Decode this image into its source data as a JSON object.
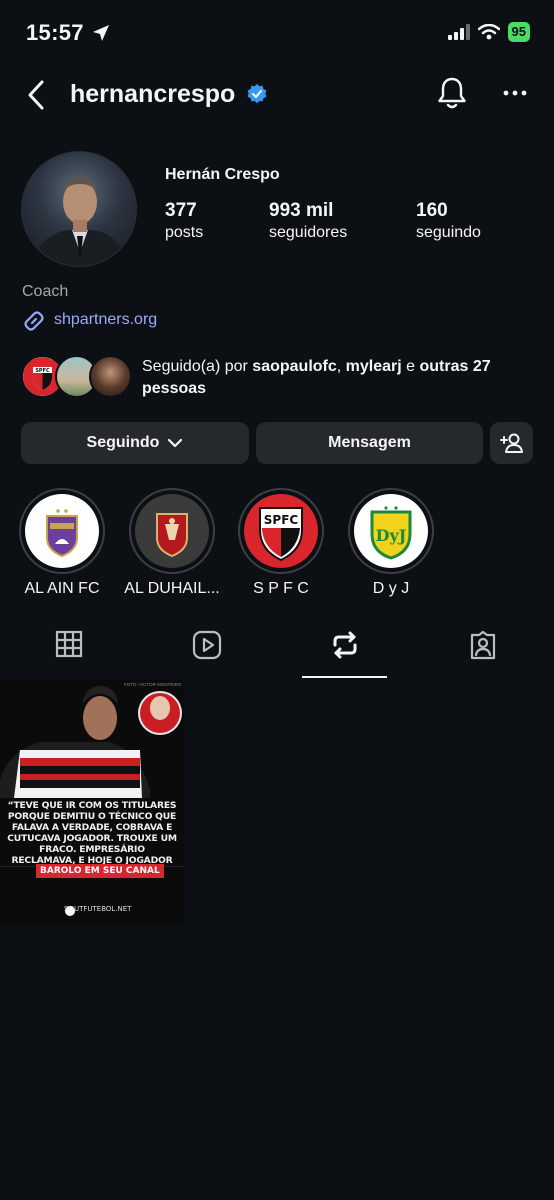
{
  "status_bar": {
    "time": "15:57",
    "battery": "95"
  },
  "header": {
    "username": "hernancrespo"
  },
  "profile": {
    "full_name": "Hernán Crespo",
    "stats": [
      {
        "value": "377",
        "label": "posts"
      },
      {
        "value": "993 mil",
        "label": "seguidores"
      },
      {
        "value": "160",
        "label": "seguindo"
      }
    ],
    "bio": "Coach",
    "link": "shpartners.org",
    "followed_by": {
      "prefix": "Seguido(a) por ",
      "user1": "saopaulofc",
      "sep": ", ",
      "user2": "mylearj",
      "mid": " e ",
      "rest": "outras 27 pessoas"
    }
  },
  "buttons": {
    "following": "Seguindo",
    "message": "Mensagem"
  },
  "highlights": [
    {
      "label": "AL AIN FC"
    },
    {
      "label": "AL DUHAIL..."
    },
    {
      "label": "S P F C"
    },
    {
      "label": "D y J"
    }
  ],
  "tabs": [
    {
      "name": "grid",
      "icon": "grid-icon"
    },
    {
      "name": "reels",
      "icon": "reels-icon"
    },
    {
      "name": "reposts",
      "icon": "repost-icon",
      "active": true
    },
    {
      "name": "tagged",
      "icon": "tagged-icon"
    }
  ],
  "post": {
    "credit": "FOTO: VICTOR MONTEIRO",
    "quote": "“TEVE QUE IR COM OS TITULARES PORQUE DEMITIU O TÉCNICO QUE FALAVA A VERDADE, COBRAVA E CUTUCAVA JOGADOR. TROUXE UM FRACO. EMPRESÁRIO RECLAMAVA, E HOJE O JOGADOR VIROU TITULAR.”",
    "tag": "BAROLO EM SEU CANAL",
    "site": "SOUTFUTEBOL.NET"
  },
  "colors": {
    "background": "#0c1014",
    "button": "#25292e",
    "link": "#9aa9ff",
    "verified": "#3897f0",
    "battery": "#4cd964",
    "sao_paulo_red": "#d9262c"
  }
}
